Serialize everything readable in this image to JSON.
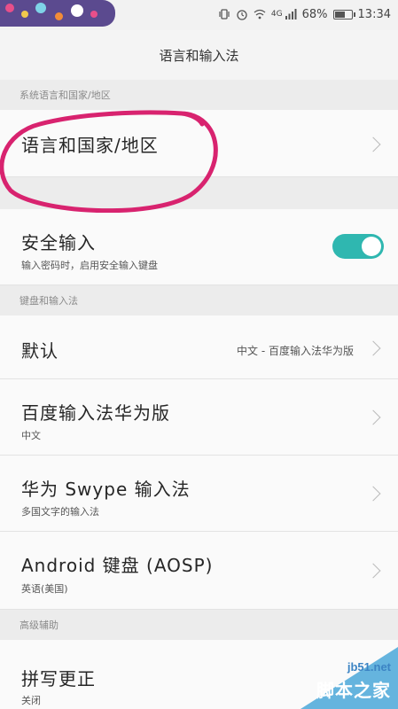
{
  "status_bar": {
    "network": "4G",
    "battery": "68%",
    "battery_level": 0.68,
    "time": "13:34",
    "icons": [
      "vibrate-icon",
      "alarm-icon",
      "wifi-icon",
      "signal-icon",
      "battery-icon"
    ]
  },
  "title": "语言和输入法",
  "sections": {
    "system_language": "系统语言和国家/地区",
    "keyboard": "键盘和输入法",
    "advanced": "高级辅助"
  },
  "language_region": {
    "label": "语言和国家/地区"
  },
  "secure_input": {
    "label": "安全输入",
    "description": "输入密码时，启用安全输入键盘",
    "enabled": true,
    "accent_color": "#2fb7b0"
  },
  "default_keyboard": {
    "label": "默认",
    "value": "中文 - 百度输入法华为版"
  },
  "keyboards": [
    {
      "label": "百度输入法华为版",
      "sub": "中文"
    },
    {
      "label": "华为 Swype 输入法",
      "sub": "多国文字的输入法"
    },
    {
      "label": "Android 键盘 (AOSP)",
      "sub": "英语(美国)"
    }
  ],
  "spell_check": {
    "label": "拼写更正",
    "sub": "关闭"
  },
  "annotation_color": "#d8236f",
  "watermark": {
    "top": "jb51.net",
    "bottom": "脚本之家"
  }
}
